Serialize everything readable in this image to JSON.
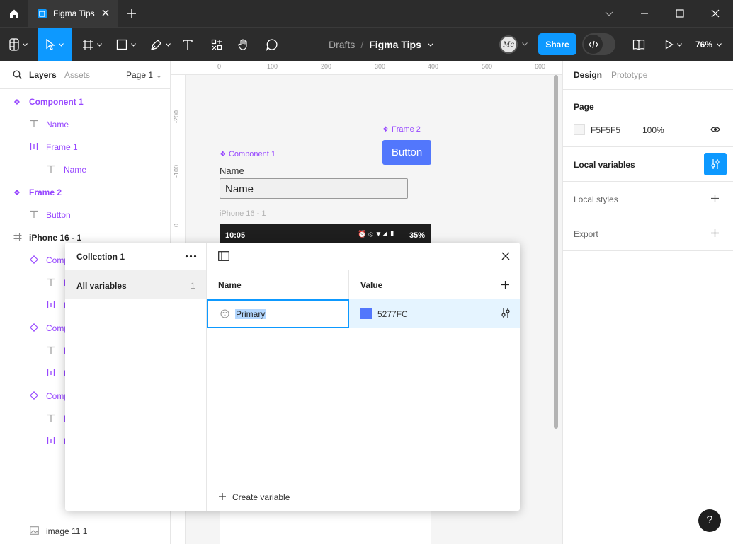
{
  "titlebar": {
    "tab_title": "Figma Tips"
  },
  "toolbar": {
    "breadcrumb_parent": "Drafts",
    "breadcrumb_file": "Figma Tips",
    "share_label": "Share",
    "zoom": "76%",
    "avatar_initials": "Mc"
  },
  "left_panel": {
    "tabs": {
      "layers": "Layers",
      "assets": "Assets"
    },
    "page_select": "Page 1",
    "layers": [
      {
        "name": "Component 1",
        "icon": "component-icon",
        "indent": 0,
        "purple": true
      },
      {
        "name": "Name",
        "icon": "text-icon",
        "indent": 1,
        "purple": true
      },
      {
        "name": "Frame 1",
        "icon": "autolayout-icon",
        "indent": 1,
        "purple": true
      },
      {
        "name": "Name",
        "icon": "text-icon",
        "indent": 2,
        "purple": true
      },
      {
        "name": "Frame 2",
        "icon": "component-icon",
        "indent": 0,
        "purple": true
      },
      {
        "name": "Button",
        "icon": "text-icon",
        "indent": 1,
        "purple": true
      },
      {
        "name": "iPhone 16 - 1",
        "icon": "frame-icon",
        "indent": 0,
        "purple": false
      },
      {
        "name": "Comp",
        "icon": "instance-icon",
        "indent": 1,
        "purple": true
      },
      {
        "name": "N",
        "icon": "text-icon",
        "indent": 2,
        "purple": true
      },
      {
        "name": "F",
        "icon": "autolayout-icon",
        "indent": 2,
        "purple": true
      },
      {
        "name": "Comp",
        "icon": "instance-icon",
        "indent": 1,
        "purple": true
      },
      {
        "name": "N",
        "icon": "text-icon",
        "indent": 2,
        "purple": true
      },
      {
        "name": "F",
        "icon": "autolayout-icon",
        "indent": 2,
        "purple": true
      },
      {
        "name": "Comp",
        "icon": "instance-icon",
        "indent": 1,
        "purple": true
      },
      {
        "name": "N",
        "icon": "text-icon",
        "indent": 2,
        "purple": true
      },
      {
        "name": "F",
        "icon": "autolayout-icon",
        "indent": 2,
        "purple": true
      }
    ],
    "bottom_layer": {
      "name": "image 11 1",
      "icon": "image-icon"
    }
  },
  "canvas": {
    "ruler_top": [
      "0",
      "100",
      "200",
      "300",
      "400",
      "500",
      "600"
    ],
    "ruler_left": [
      "-200",
      "-100",
      "0"
    ],
    "component1_label": "Component 1",
    "name_label": "Name",
    "name_input": "Name",
    "frame2_label": "Frame 2",
    "button_label": "Button",
    "iphone_label": "iPhone 16 - 1",
    "status_time": "10:05",
    "status_battery": "35%"
  },
  "right_panel": {
    "tabs": {
      "design": "Design",
      "prototype": "Prototype"
    },
    "page_title": "Page",
    "page_color": "F5F5F5",
    "page_opacity": "100%",
    "local_variables": "Local variables",
    "local_styles": "Local styles",
    "export": "Export"
  },
  "variables_dialog": {
    "collection_name": "Collection 1",
    "all_variables_label": "All variables",
    "all_variables_count": "1",
    "col_name": "Name",
    "col_value": "Value",
    "rows": [
      {
        "name": "Primary",
        "value": "5277FC",
        "color": "#5277fc"
      }
    ],
    "create_variable": "Create variable"
  },
  "help_label": "?",
  "colors": {
    "accent": "#0d99ff",
    "component": "#9747ff",
    "primary_var": "#5277fc"
  }
}
